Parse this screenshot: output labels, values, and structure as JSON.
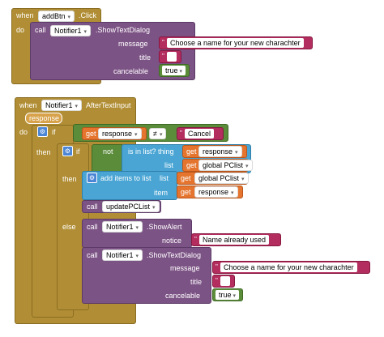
{
  "block1": {
    "when": "when",
    "component": "addBtn",
    "event": ".Click",
    "do": "do",
    "call": "call",
    "notifier": "Notifier1",
    "method": ".ShowTextDialog",
    "message_label": "message",
    "message_value": "Choose a name for your new charachter",
    "title_label": "title",
    "title_value": "",
    "cancelable_label": "cancelable",
    "cancelable_value": "true"
  },
  "block2": {
    "when": "when",
    "component": "Notifier1",
    "event": "AfterTextInput",
    "param": "response",
    "do": "do",
    "if": "if",
    "get": "get",
    "response_var": "response",
    "neq": "≠",
    "cancel_value": "Cancel",
    "then": "then",
    "if2": "if",
    "not": "not",
    "is_in_list": "is in list? thing",
    "list_label": "list",
    "global_pclist": "global PClist",
    "add_items": "add items to list",
    "item_label": "item",
    "call": "call",
    "update_pclist": "updatePCList",
    "else": "else",
    "notifier": "Notifier1",
    "show_alert": ".ShowAlert",
    "notice_label": "notice",
    "notice_value": "Name already used",
    "show_text_dialog": ".ShowTextDialog",
    "message_label": "message",
    "message_value": "Choose a name for your new charachter",
    "title_label": "title",
    "title_value": "",
    "cancelable_label": "cancelable",
    "cancelable_value": "true"
  }
}
